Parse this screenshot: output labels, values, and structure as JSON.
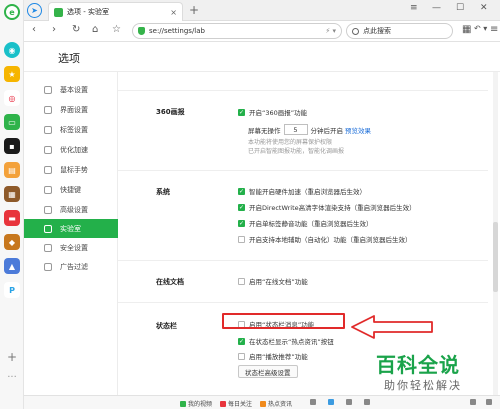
{
  "window": {
    "tab_title": "选项 - 实验室",
    "close_tab": "×",
    "new_tab": "+",
    "ctl_menu": "≡",
    "ctl_min": "—",
    "ctl_max": "☐",
    "ctl_close": "✕"
  },
  "toolbar": {
    "back": "‹",
    "forward": "›",
    "refresh": "↻",
    "home": "⌂",
    "star": "☆",
    "url": "se://settings/lab",
    "ext_icon": "⚡ ▾",
    "search_placeholder": "点此搜索",
    "grid": "▦",
    "undo": "↶ ▾",
    "menu": "≡"
  },
  "settings": {
    "title": "选项"
  },
  "nav": {
    "items": [
      {
        "label": "基本设置",
        "icon": "basic-settings-icon"
      },
      {
        "label": "界面设置",
        "icon": "interface-icon"
      },
      {
        "label": "标签设置",
        "icon": "tab-settings-icon"
      },
      {
        "label": "优化加速",
        "icon": "speed-icon"
      },
      {
        "label": "鼠标手势",
        "icon": "mouse-gesture-icon"
      },
      {
        "label": "快捷键",
        "icon": "keyboard-icon"
      },
      {
        "label": "高级设置",
        "icon": "advanced-icon"
      },
      {
        "label": "实验室",
        "icon": "lab-icon",
        "active": true
      },
      {
        "label": "安全设置",
        "icon": "security-icon"
      },
      {
        "label": "广告过滤",
        "icon": "ad-filter-icon"
      }
    ]
  },
  "sections": {
    "s360": {
      "title": "360画报",
      "enable": "开启“360画报”功能",
      "screen_pre": "屏幕无操作",
      "minutes": "5",
      "screen_post": "分钟后开启",
      "preview": "预览效果",
      "note1": "本功能将使用您的屏幕保护权限",
      "note2": "已开启智能图报功能，智能化调画报"
    },
    "system": {
      "title": "系统",
      "opt1": "智能开启硬件加速（重启浏览器后生效）",
      "opt2": "开启DirectWrite高清字体渲染支持（重启浏览器后生效）",
      "opt3": "开启单标签静音功能（重启浏览器后生效）",
      "opt4": "开启支持本地辅助（自动化）功能（重启浏览器后生效）"
    },
    "online_doc": {
      "title": "在线文档",
      "opt1": "启用“在线文档”功能"
    },
    "statusbar": {
      "title": "状态栏",
      "opt1": "启用“状态栏消息”功能",
      "opt2": "在状态栏显示“热点资讯”按钮",
      "opt3": "启用“播放推荐”功能",
      "button": "状态栏高级设置"
    }
  },
  "bottom": {
    "items": [
      "我的视频",
      "每日关注",
      "热点资讯",
      "",
      "",
      "",
      "",
      "",
      ""
    ]
  },
  "watermark": {
    "line1": "百科全说",
    "line2": "助你轻松解决"
  },
  "colors": {
    "accent": "#23b04a",
    "highlight_box": "#e12a2a",
    "link": "#1e6fd9"
  }
}
